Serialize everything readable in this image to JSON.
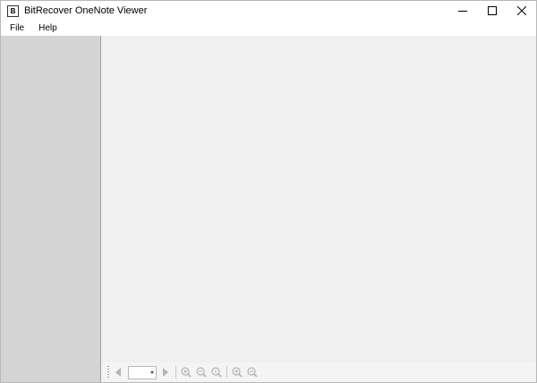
{
  "window": {
    "title": "BitRecover OneNote Viewer",
    "app_icon_glyph": "B"
  },
  "menu": {
    "items": [
      {
        "label": "File"
      },
      {
        "label": "Help"
      }
    ]
  },
  "toolbar": {
    "page_number": "",
    "icons": [
      "prev-page-icon",
      "next-page-icon",
      "zoom-in-icon",
      "zoom-out-icon",
      "actual-size-icon",
      "zoom-in-alt-icon",
      "zoom-out-alt-icon"
    ]
  },
  "colors": {
    "sidebar": "#d4d4d4",
    "canvas": "#f0f0f0",
    "icon_disabled": "#b4b4b4"
  }
}
